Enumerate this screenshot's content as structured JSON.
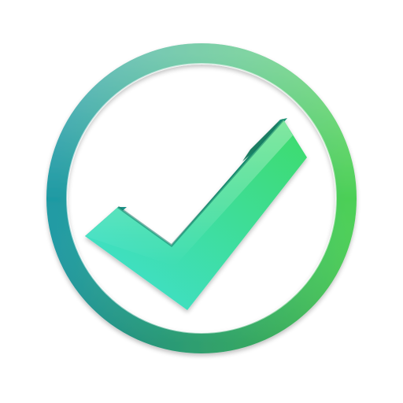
{
  "icon": {
    "name": "check-circle-icon",
    "colors": {
      "background": "#ffffff",
      "ring_teal": "#1f9aa3",
      "ring_green": "#4ccf57",
      "check_cyan": "#3fe0d6",
      "check_green": "#3edb6a",
      "check_shadow": "#17856f"
    }
  }
}
